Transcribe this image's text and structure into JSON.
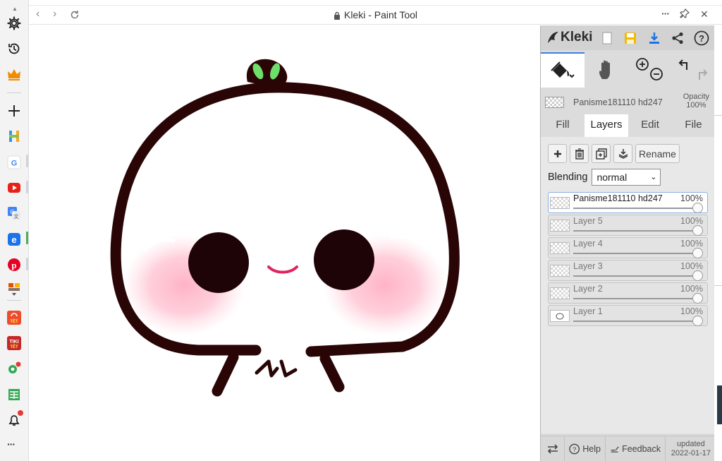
{
  "window": {
    "title": "Kleki - Paint Tool",
    "back_glyph": "‹",
    "forward_glyph": "›",
    "more_glyph": "···",
    "close_glyph": "✕"
  },
  "sidebar": {
    "icons": [
      "gear-icon",
      "history-icon",
      "crown-icon",
      "plus-icon",
      "hotdeal-icon",
      "google-icon",
      "youtube-icon",
      "translate-icon",
      "edge-icon",
      "pinterest-icon",
      "shopee-icon",
      "tiki-icon",
      "sheet-icon",
      "bell-icon",
      "more-icon"
    ],
    "more_glyph": "···"
  },
  "app": {
    "logo_text": "Kleki",
    "accent_color": "#3d7fd9"
  },
  "layer_info": {
    "name": "Panisme181110 hd247",
    "opacity_label": "Opacity",
    "opacity_value": "100%"
  },
  "tabs": [
    "Fill",
    "Layers",
    "Edit",
    "File"
  ],
  "active_tab": "Layers",
  "layer_buttons": {
    "rename_label": "Rename"
  },
  "blending": {
    "label": "Blending",
    "value": "normal"
  },
  "layers": [
    {
      "name": "Panisme181110 hd247",
      "opacity": "100%",
      "active": true
    },
    {
      "name": "Layer 5",
      "opacity": "100%",
      "active": false
    },
    {
      "name": "Layer 4",
      "opacity": "100%",
      "active": false
    },
    {
      "name": "Layer 3",
      "opacity": "100%",
      "active": false
    },
    {
      "name": "Layer 2",
      "opacity": "100%",
      "active": false
    },
    {
      "name": "Layer 1",
      "opacity": "100%",
      "active": false
    }
  ],
  "footer": {
    "help_label": "Help",
    "feedback_label": "Feedback",
    "updated_label": "updated",
    "updated_date": "2022-01-17"
  }
}
